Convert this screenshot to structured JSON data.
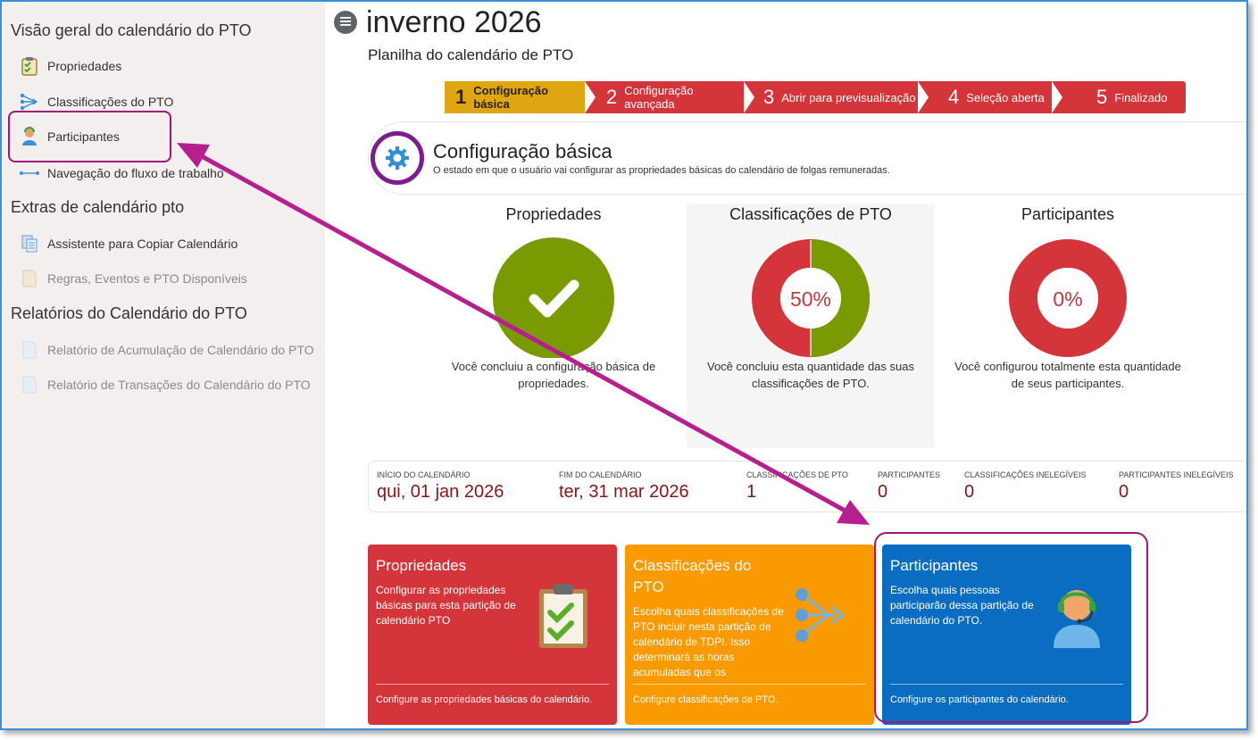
{
  "sidebar": {
    "overview_heading": "Visão geral do calendário do PTO",
    "overview_items": [
      {
        "label": "Propriedades",
        "icon": "clipboard-check-icon"
      },
      {
        "label": "Classificações do PTO",
        "icon": "branch-arrows-icon"
      },
      {
        "label": "Participantes",
        "icon": "person-headset-icon"
      },
      {
        "label": "Navegação do fluxo de trabalho",
        "icon": "workflow-arrow-icon"
      }
    ],
    "extras_heading": "Extras de calendário pto",
    "extras_items": [
      {
        "label": "Assistente para Copiar Calendário",
        "icon": "copy-pages-icon"
      },
      {
        "label": "Regras, Eventos e PTO Disponíveis",
        "icon": "document-icon"
      }
    ],
    "reports_heading": "Relatórios do Calendário do PTO",
    "reports_items": [
      {
        "label": "Relatório de Acumulação de Calendário do PTO",
        "icon": "report-document-icon"
      },
      {
        "label": "Relatório de Transações do Calendário do PTO",
        "icon": "report-document-icon"
      }
    ]
  },
  "header": {
    "title": "inverno 2026",
    "subtitle": "Planilha do calendário de PTO"
  },
  "steps": [
    {
      "num": "1",
      "label": "Configuração básica",
      "state": "active"
    },
    {
      "num": "2",
      "label": "Configuração avançada",
      "state": "pending"
    },
    {
      "num": "3",
      "label": "Abrir para previsualização",
      "state": "pending"
    },
    {
      "num": "4",
      "label": "Seleção aberta",
      "state": "pending"
    },
    {
      "num": "5",
      "label": "Finalizado",
      "state": "pending"
    }
  ],
  "config": {
    "title": "Configuração básica",
    "description": "O estado em que o usuário vai configurar as propriedades básicas do calendário de folgas remuneradas."
  },
  "stats": [
    {
      "title": "Propriedades",
      "complete_fraction": 1.0,
      "display": "",
      "description": "Você concluiu a configuração básica de propriedades."
    },
    {
      "title": "Classificações de PTO",
      "complete_fraction": 0.5,
      "display": "50%",
      "description": "Você concluiu esta quantidade das suas classificações de PTO."
    },
    {
      "title": "Participantes",
      "complete_fraction": 0.0,
      "display": "0%",
      "description": "Você configurou totalmente esta quantidade de seus participantes."
    }
  ],
  "info": [
    {
      "label": "Início do calendário",
      "value": "qui, 01 jan 2026"
    },
    {
      "label": "Fim do calendário",
      "value": "ter, 31 mar 2026"
    },
    {
      "label": "Classificações de PTO",
      "value": "1"
    },
    {
      "label": "Participantes",
      "value": "0"
    },
    {
      "label": "Classificações inelegíveis",
      "value": "0"
    },
    {
      "label": "Participantes inelegíveis",
      "value": "0"
    }
  ],
  "cards": [
    {
      "title": "Propriedades",
      "description": "Configurar as propriedades básicas para esta partição de calendário PTO",
      "footer": "Configure as propriedades básicas do calendário.",
      "icon": "clipboard-check-icon"
    },
    {
      "title": "Classificações do PTO",
      "description": "Escolha quais classificações de PTO incluir nesta partição de calendário de TDPI. Isso determinará as horas acumuladas que os",
      "footer": "Configure classificações de PTO.",
      "icon": "branch-arrows-icon"
    },
    {
      "title": "Participantes",
      "description": "Escolha quais pessoas participarão dessa partição de calendário do PTO.",
      "footer": "Configure os participantes do calendário.",
      "icon": "person-headset-icon"
    }
  ],
  "colors": {
    "green": "#7a9a01",
    "red": "#d3353b",
    "amber": "#e0a612",
    "orange": "#f89a00",
    "blue": "#0a6dc2",
    "annotation": "#b5208e",
    "value_text": "#8b1418"
  }
}
